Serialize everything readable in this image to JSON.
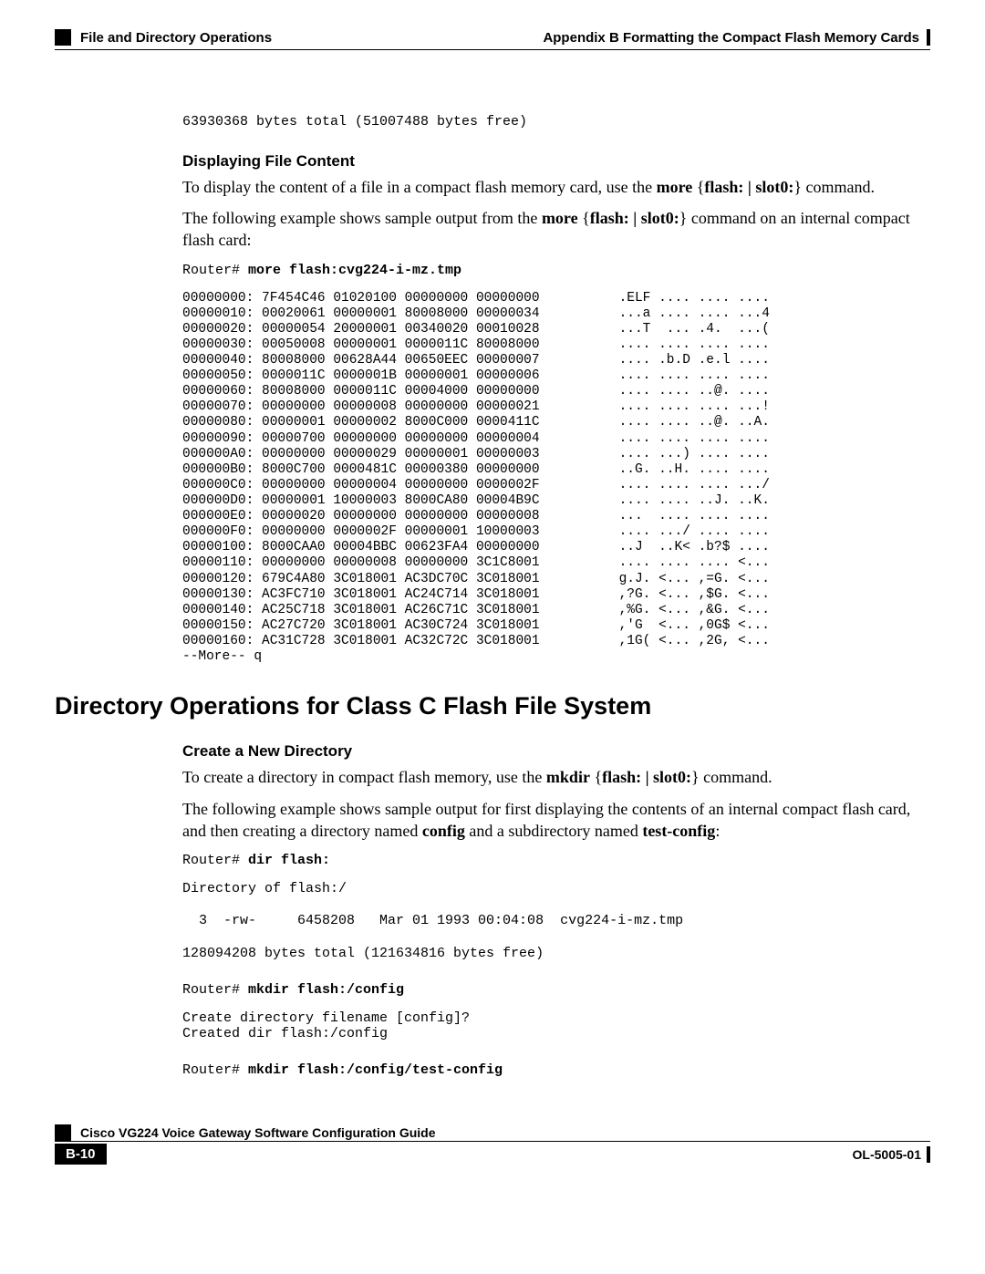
{
  "header": {
    "appendix": "Appendix B      Formatting the Compact Flash Memory Cards",
    "section": "File and Directory Operations"
  },
  "block1": {
    "bytes_line": "63930368 bytes total (51007488 bytes free)"
  },
  "display_file": {
    "heading": "Displaying File Content",
    "para1_pre": "To display the content of a file in a compact flash memory card, use the ",
    "para1_cmd1": "more",
    "para1_mid1": " {",
    "para1_cmd2": "flash: | slot0:",
    "para1_mid2": "} command.",
    "para2_pre": "The following example shows sample output from the ",
    "para2_cmd1": "more",
    "para2_mid1": " {",
    "para2_cmd2": "flash: | slot0:",
    "para2_mid2": "} command on an internal compact flash card:",
    "router_prompt": "Router# ",
    "router_cmd": "more flash:cvg224-i-mz.tmp",
    "hexdump": "00000000: 7F454C46 01020100 00000000 00000000          .ELF .... .... ....\n00000010: 00020061 00000001 80008000 00000034          ...a .... .... ...4\n00000020: 00000054 20000001 00340020 00010028          ...T  ... .4.  ...(\n00000030: 00050008 00000001 0000011C 80008000          .... .... .... ....\n00000040: 80008000 00628A44 00650EEC 00000007          .... .b.D .e.l ....\n00000050: 0000011C 0000001B 00000001 00000006          .... .... .... ....\n00000060: 80008000 0000011C 00004000 00000000          .... .... ..@. ....\n00000070: 00000000 00000008 00000000 00000021          .... .... .... ...!\n00000080: 00000001 00000002 8000C000 0000411C          .... .... ..@. ..A.\n00000090: 00000700 00000000 00000000 00000004          .... .... .... ....\n000000A0: 00000000 00000029 00000001 00000003          .... ...) .... ....\n000000B0: 8000C700 0000481C 00000380 00000000          ..G. ..H. .... ....\n000000C0: 00000000 00000004 00000000 0000002F          .... .... .... .../\n000000D0: 00000001 10000003 8000CA80 00004B9C          .... .... ..J. ..K.\n000000E0: 00000020 00000000 00000000 00000008          ...  .... .... ....\n000000F0: 00000000 0000002F 00000001 10000003          .... .../ .... ....\n00000100: 8000CAA0 00004BBC 00623FA4 00000000          ..J  ..K< .b?$ ....\n00000110: 00000000 00000008 00000000 3C1C8001          .... .... .... <...\n00000120: 679C4A80 3C018001 AC3DC70C 3C018001          g.J. <... ,=G. <...\n00000130: AC3FC710 3C018001 AC24C714 3C018001          ,?G. <... ,$G. <...\n00000140: AC25C718 3C018001 AC26C71C 3C018001          ,%G. <... ,&G. <...\n00000150: AC27C720 3C018001 AC30C724 3C018001          ,'G  <... ,0G$ <...\n00000160: AC31C728 3C018001 AC32C72C 3C018001          ,1G( <... ,2G, <...\n--More-- q"
  },
  "dir_ops": {
    "title": "Directory Operations for Class C Flash File System",
    "sub_heading": "Create a New Directory",
    "para1_pre": "To create a directory in compact flash memory, use the ",
    "para1_cmd1": "mkdir",
    "para1_mid1": " {",
    "para1_cmd2": "flash: | slot0:",
    "para1_mid2": "} command.",
    "para2_pre": "The following example shows sample output for first displaying the contents of an internal compact flash card, and then creating a directory named ",
    "para2_b1": "config",
    "para2_mid": " and a subdirectory named  ",
    "para2_b2": "test-config",
    "para2_end": ":",
    "prompt1": "Router# ",
    "cmd1": "dir flash:",
    "out1": "Directory of flash:/\n\n  3  -rw-     6458208   Mar 01 1993 00:04:08  cvg224-i-mz.tmp\n\n128094208 bytes total (121634816 bytes free)",
    "prompt2": "Router# ",
    "cmd2": "mkdir flash:/config",
    "out2": "Create directory filename [config]?\nCreated dir flash:/config",
    "prompt3": "Router# ",
    "cmd3": "mkdir flash:/config/test-config"
  },
  "footer": {
    "doc_title": "Cisco VG224 Voice Gateway Software Configuration Guide",
    "page_num": "B-10",
    "doc_id": "OL-5005-01"
  }
}
